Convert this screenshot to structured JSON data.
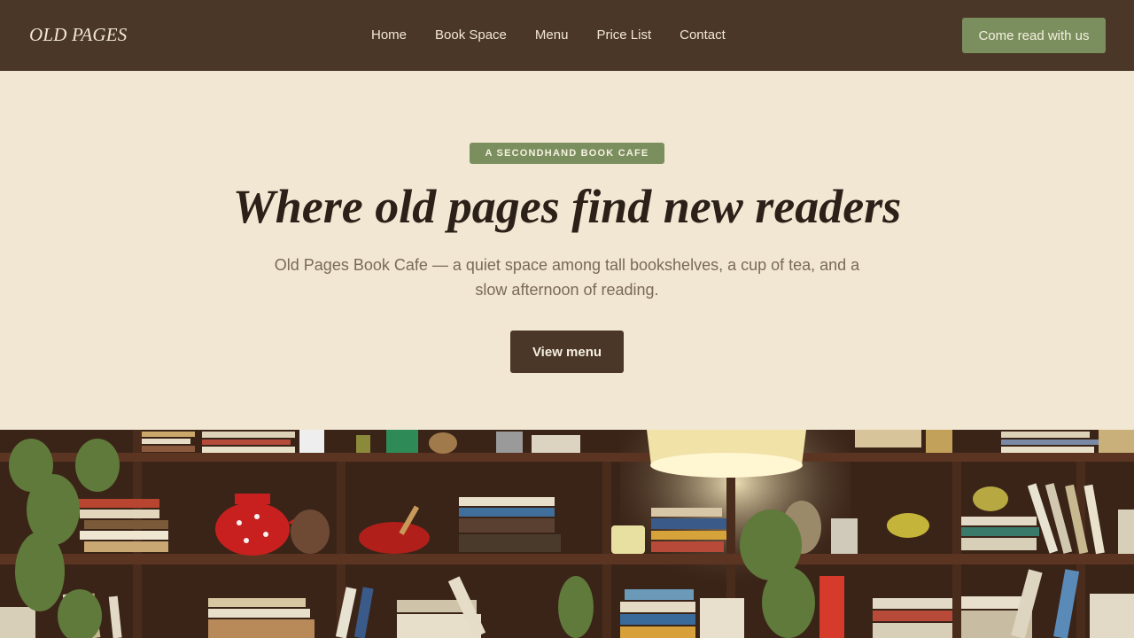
{
  "header": {
    "logo": "OLD PAGES",
    "nav": [
      "Home",
      "Book Space",
      "Menu",
      "Price List",
      "Contact"
    ],
    "cta_label": "Come read with us"
  },
  "hero": {
    "badge": "A SECONDHAND BOOK CAFE",
    "headline": "Where old pages find new readers",
    "subtitle": "Old Pages Book Cafe — a quiet space among tall bookshelves, a cup of tea, and a slow afternoon of reading.",
    "button_label": "View menu"
  },
  "colors": {
    "header_bg": "#4a3728",
    "page_bg": "#f2e7d3",
    "accent_green": "#7b8f5e",
    "dark_brown": "#4a3728"
  },
  "photo": {
    "icon": "bookshelf-photo"
  }
}
